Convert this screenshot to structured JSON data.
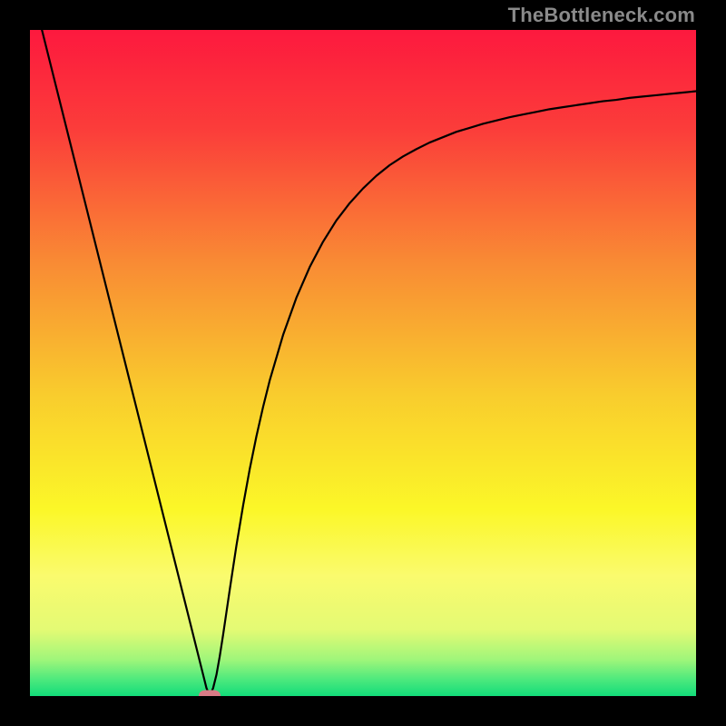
{
  "watermark": "TheBottleneck.com",
  "colors": {
    "gradient_stops": [
      {
        "offset": 0.0,
        "color": "#fd193e"
      },
      {
        "offset": 0.15,
        "color": "#fb3d3a"
      },
      {
        "offset": 0.35,
        "color": "#f98b34"
      },
      {
        "offset": 0.55,
        "color": "#f9cd2d"
      },
      {
        "offset": 0.72,
        "color": "#fbf728"
      },
      {
        "offset": 0.82,
        "color": "#fafb6e"
      },
      {
        "offset": 0.9,
        "color": "#e4fa74"
      },
      {
        "offset": 0.945,
        "color": "#a0f67a"
      },
      {
        "offset": 0.975,
        "color": "#4de97d"
      },
      {
        "offset": 1.0,
        "color": "#12dc7a"
      }
    ],
    "curve": "#000000",
    "marker": "#d97b86",
    "frame": "#000000"
  },
  "chart_data": {
    "type": "line",
    "title": "",
    "xlabel": "",
    "ylabel": "",
    "xlim": [
      0,
      1
    ],
    "ylim": [
      0,
      1
    ],
    "x": [
      0.0,
      0.01,
      0.02,
      0.03,
      0.04,
      0.05,
      0.06,
      0.07,
      0.08,
      0.09,
      0.1,
      0.11,
      0.12,
      0.13,
      0.14,
      0.15,
      0.16,
      0.17,
      0.18,
      0.19,
      0.2,
      0.21,
      0.22,
      0.23,
      0.24,
      0.25,
      0.26,
      0.265,
      0.27,
      0.275,
      0.28,
      0.285,
      0.29,
      0.295,
      0.3,
      0.31,
      0.32,
      0.33,
      0.34,
      0.35,
      0.36,
      0.38,
      0.4,
      0.42,
      0.44,
      0.46,
      0.48,
      0.5,
      0.52,
      0.54,
      0.56,
      0.58,
      0.6,
      0.62,
      0.64,
      0.66,
      0.68,
      0.7,
      0.72,
      0.74,
      0.76,
      0.78,
      0.8,
      0.82,
      0.84,
      0.86,
      0.88,
      0.9,
      0.92,
      0.94,
      0.96,
      0.98,
      1.0
    ],
    "values": [
      1.072,
      1.032,
      0.992,
      0.952,
      0.912,
      0.872,
      0.832,
      0.792,
      0.752,
      0.712,
      0.672,
      0.632,
      0.592,
      0.552,
      0.512,
      0.472,
      0.432,
      0.392,
      0.352,
      0.312,
      0.272,
      0.232,
      0.192,
      0.152,
      0.112,
      0.072,
      0.032,
      0.012,
      0.0,
      0.012,
      0.032,
      0.06,
      0.092,
      0.126,
      0.16,
      0.226,
      0.286,
      0.341,
      0.39,
      0.434,
      0.474,
      0.542,
      0.598,
      0.644,
      0.682,
      0.714,
      0.74,
      0.762,
      0.781,
      0.797,
      0.81,
      0.821,
      0.831,
      0.839,
      0.847,
      0.853,
      0.859,
      0.864,
      0.869,
      0.873,
      0.877,
      0.881,
      0.884,
      0.887,
      0.89,
      0.893,
      0.895,
      0.898,
      0.9,
      0.902,
      0.904,
      0.906,
      0.908
    ],
    "min_point": {
      "x": 0.27,
      "y": 0.0
    }
  }
}
